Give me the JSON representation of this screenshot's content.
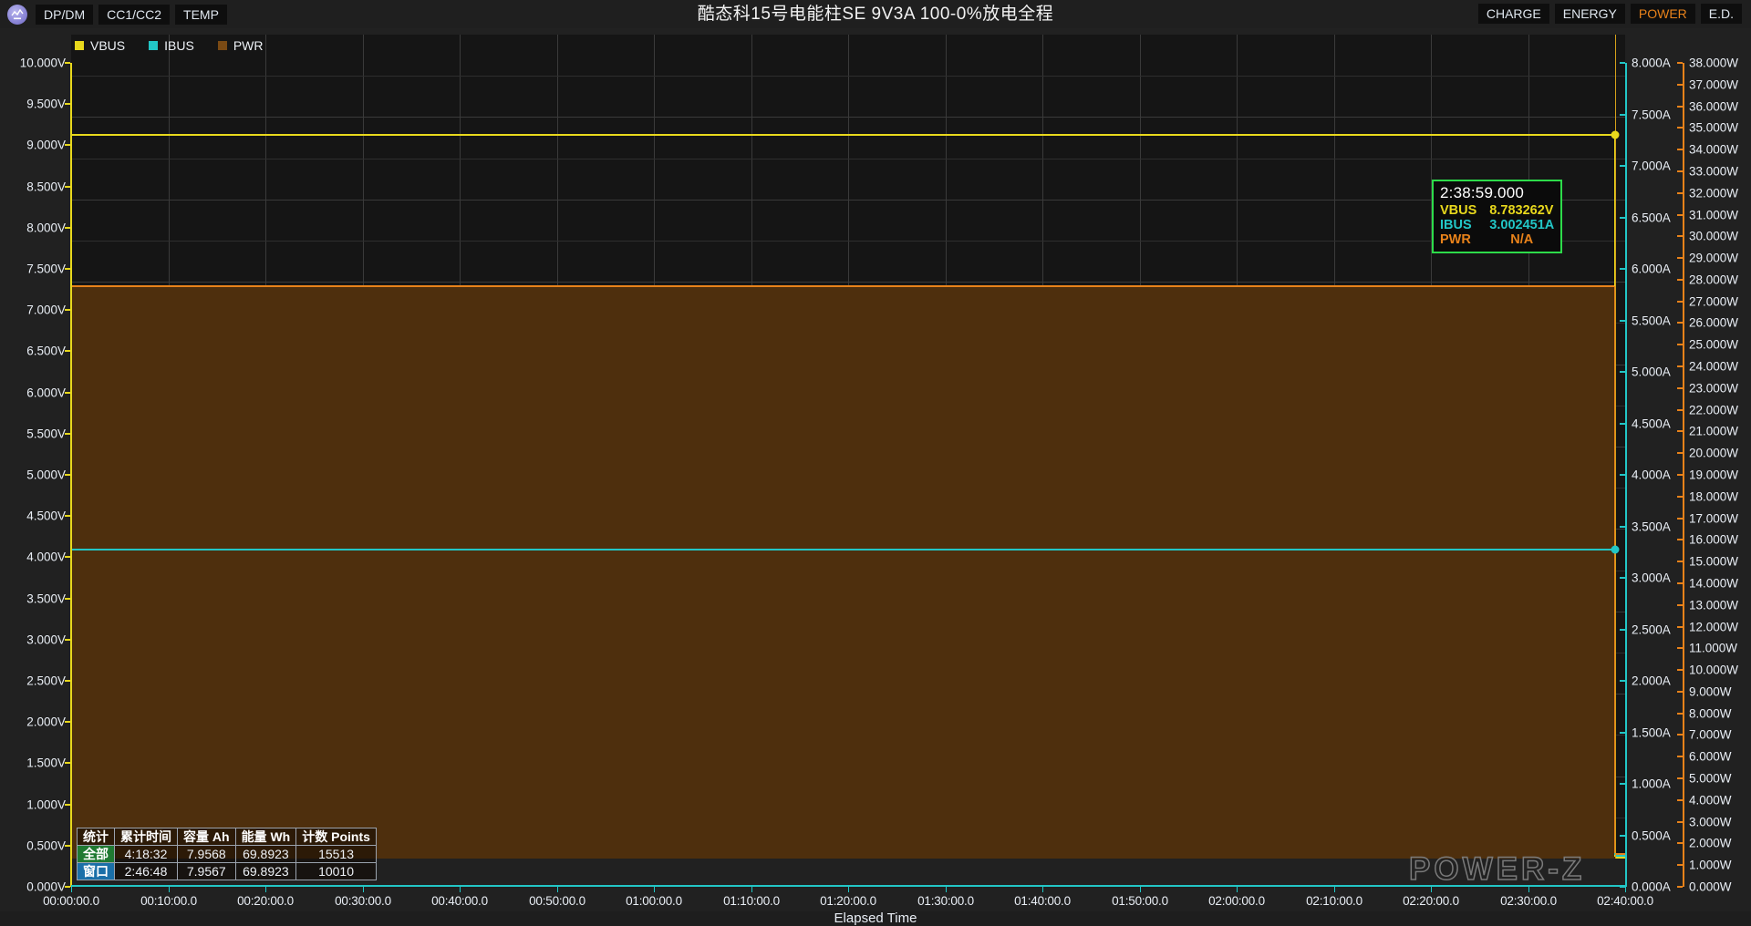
{
  "topbar": {
    "logo_icon": "powerz-logo-icon",
    "left_tabs": [
      {
        "label": "DP/DM",
        "accent": false
      },
      {
        "label": "CC1/CC2",
        "accent": false
      },
      {
        "label": "TEMP",
        "accent": false
      }
    ],
    "title": "酷态科15号电能柱SE 9V3A 100-0%放电全程",
    "right_tabs": [
      {
        "label": "CHARGE",
        "accent": false
      },
      {
        "label": "ENERGY",
        "accent": false
      },
      {
        "label": "POWER",
        "accent": true
      },
      {
        "label": "E.D.",
        "accent": false
      }
    ]
  },
  "legend": [
    {
      "label": "VBUS",
      "color": "#e8d81c"
    },
    {
      "label": "IBUS",
      "color": "#22c6c6"
    },
    {
      "label": "PWR",
      "color": "#7a4a14"
    }
  ],
  "tooltip": {
    "time": "2:38:59.000",
    "rows": [
      {
        "key": "VBUS",
        "value": "8.783262V",
        "color": "#e8d81c"
      },
      {
        "key": "IBUS",
        "value": "3.002451A",
        "color": "#22c6c6"
      },
      {
        "key": "PWR",
        "value": "N/A",
        "color": "#e8821a"
      }
    ]
  },
  "stats": {
    "headers": [
      "统计",
      "累计时间",
      "容量 Ah",
      "能量 Wh",
      "计数 Points"
    ],
    "rows": [
      {
        "label": "全部",
        "label_color": "#1f7a32",
        "cells": [
          "4:18:32",
          "7.9568",
          "69.8923",
          "15513"
        ]
      },
      {
        "label": "窗口",
        "label_color": "#1a6fa8",
        "cells": [
          "2:46:48",
          "7.9567",
          "69.8923",
          "10010"
        ]
      }
    ]
  },
  "watermark": "POWER-Z",
  "chart_data": {
    "type": "line",
    "title": "酷态科15号电能柱SE 9V3A 100-0%放电全程",
    "xlabel": "Elapsed Time",
    "ylabel": "",
    "grid": true,
    "legend_position": "top-left",
    "x_ticks": [
      "00:00:00.0",
      "00:10:00.0",
      "00:20:00.0",
      "00:30:00.0",
      "00:40:00.0",
      "00:50:00.0",
      "01:00:00.0",
      "01:10:00.0",
      "01:20:00.0",
      "01:30:00.0",
      "01:40:00.0",
      "01:50:00.0",
      "02:00:00.0",
      "02:10:00.0",
      "02:20:00.0",
      "02:30:00.0",
      "02:40:00.0"
    ],
    "xlim_seconds": [
      0,
      9600
    ],
    "axes": [
      {
        "name": "VBUS",
        "side": "left",
        "unit": "V",
        "color": "#e8d81c",
        "ylim": [
          0,
          10
        ],
        "tick_step": 0.5,
        "tick_labels": [
          "10.000V",
          "9.500V",
          "9.000V",
          "8.500V",
          "8.000V",
          "7.500V",
          "7.000V",
          "6.500V",
          "6.000V",
          "5.500V",
          "5.000V",
          "4.500V",
          "4.000V",
          "3.500V",
          "3.000V",
          "2.500V",
          "2.000V",
          "1.500V",
          "1.000V",
          "0.500V",
          "0.000V"
        ]
      },
      {
        "name": "IBUS",
        "side": "right-inner",
        "unit": "A",
        "color": "#22c6c6",
        "ylim": [
          0,
          8
        ],
        "tick_step": 0.5,
        "tick_labels": [
          "8.000A",
          "7.500A",
          "7.000A",
          "6.500A",
          "6.000A",
          "5.500A",
          "5.000A",
          "4.500A",
          "4.000A",
          "3.500A",
          "3.000A",
          "2.500A",
          "2.000A",
          "1.500A",
          "1.000A",
          "0.500A",
          "0.000A"
        ]
      },
      {
        "name": "PWR",
        "side": "right-outer",
        "unit": "W",
        "color": "#e8821a",
        "ylim": [
          0,
          38
        ],
        "tick_step": 1,
        "tick_labels": [
          "38.000W",
          "37.000W",
          "36.000W",
          "35.000W",
          "34.000W",
          "33.000W",
          "32.000W",
          "31.000W",
          "30.000W",
          "29.000W",
          "28.000W",
          "27.000W",
          "26.000W",
          "25.000W",
          "24.000W",
          "23.000W",
          "22.000W",
          "21.000W",
          "20.000W",
          "19.000W",
          "18.000W",
          "17.000W",
          "16.000W",
          "15.000W",
          "14.000W",
          "13.000W",
          "12.000W",
          "11.000W",
          "10.000W",
          "9.000W",
          "8.000W",
          "7.000W",
          "6.000W",
          "5.000W",
          "4.000W",
          "3.000W",
          "2.000W",
          "1.000W",
          "0.000W"
        ]
      }
    ],
    "series": [
      {
        "name": "VBUS",
        "axis": "left",
        "unit": "V",
        "color": "#e8d81c",
        "style": "line",
        "plateau_value": 8.783262,
        "end_value": 0,
        "cutoff_time": "2:38:59.000"
      },
      {
        "name": "IBUS",
        "axis": "right-inner",
        "unit": "A",
        "color": "#22c6c6",
        "style": "line",
        "plateau_value": 3.002451,
        "end_value": 0,
        "cutoff_time": "2:38:59.000"
      },
      {
        "name": "PWR",
        "axis": "right-outer",
        "unit": "W",
        "color": "#e8821a",
        "fill_color": "#4e2f0d",
        "style": "area",
        "plateau_value": 26.4,
        "end_value": 0,
        "cutoff_time": "2:38:59.000"
      }
    ],
    "cursor": {
      "time": "2:38:59.000",
      "color": "#d6a11a"
    }
  }
}
